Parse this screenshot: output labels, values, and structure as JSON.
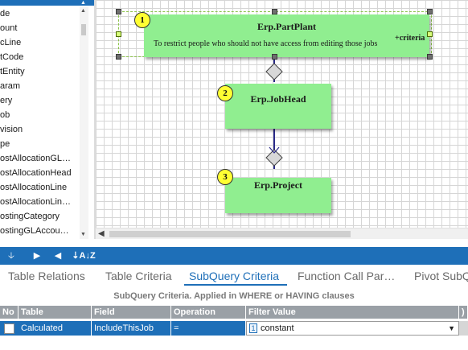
{
  "left_list": {
    "items": [
      "de",
      "ount",
      "cLine",
      "tCode",
      "tEntity",
      "aram",
      "ery",
      "ob",
      "vision",
      "pe",
      "ostAllocationGL…",
      "ostAllocationHead",
      "ostAllocationLine",
      "ostAllocationLin…",
      "ostingCategory",
      "ostingGLAccou…"
    ]
  },
  "diagram": {
    "entities": [
      {
        "number": "1",
        "name": "Erp.PartPlant",
        "description": "To restrict people who should not have access from editing those jobs",
        "criteria": "+criteria"
      },
      {
        "number": "2",
        "name": "Erp.JobHead"
      },
      {
        "number": "3",
        "name": "Erp.Project"
      }
    ]
  },
  "toolbar": {
    "down_icon": "down-arrow-icon",
    "right_icon": "right-triangle-icon",
    "left_icon": "left-triangle-icon",
    "sort_icon": "sort-az-icon"
  },
  "tabs": [
    {
      "label": "Table Relations",
      "active": false
    },
    {
      "label": "Table Criteria",
      "active": false
    },
    {
      "label": "SubQuery Criteria",
      "active": true
    },
    {
      "label": "Function Call Par…",
      "active": false
    },
    {
      "label": "Pivot SubQ",
      "active": false
    }
  ],
  "subquery": {
    "caption": "SubQuery Criteria. Applied in WHERE or HAVING clauses",
    "columns": {
      "no": "No",
      "table": "Table",
      "field": "Field",
      "operation": "Operation",
      "filter_value": "Filter Value",
      "extra": ")"
    },
    "rows": [
      {
        "table": "Calculated",
        "field": "IncludeThisJob",
        "operation": "=",
        "filter_value": "constant",
        "filter_icon": "1"
      }
    ]
  },
  "colors": {
    "accent": "#1e6fb8",
    "entity_fill": "#90ee90",
    "badge_fill": "#ffff33"
  }
}
